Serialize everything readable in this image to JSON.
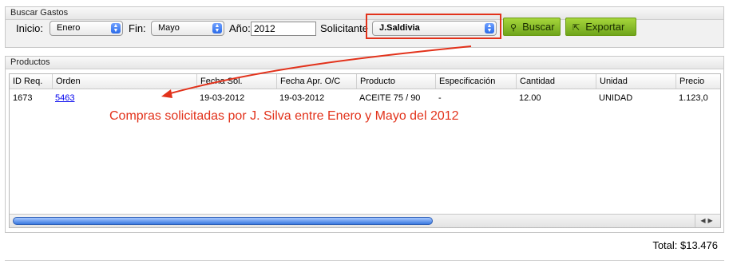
{
  "search": {
    "title": "Buscar Gastos",
    "inicio_label": "Inicio:",
    "inicio_value": "Enero",
    "fin_label": "Fin:",
    "fin_value": "Mayo",
    "anio_label": "Año:",
    "anio_value": "2012",
    "solicitante_label": "Solicitante",
    "solicitante_value": "J.Saldivia",
    "buscar_label": "Buscar",
    "exportar_label": "Exportar",
    "highlight_color": "#e2321b"
  },
  "products": {
    "title": "Productos",
    "columns": [
      "ID Req.",
      "Orden",
      "Fecha Sol.",
      "Fecha Apr. O/C",
      "Producto",
      "Especificación",
      "Cantidad",
      "Unidad",
      "Precio"
    ],
    "rows": [
      {
        "id_req": "1673",
        "orden": "5463",
        "fecha_sol": "19-03-2012",
        "fecha_apr": "19-03-2012",
        "producto": "ACEITE 75 / 90",
        "especificacion": "-",
        "cantidad": "12.00",
        "unidad": "UNIDAD",
        "precio": "1.123,0"
      }
    ]
  },
  "annotation": "Compras solicitadas por J. Silva entre Enero y Mayo del 2012",
  "total": "Total: $13.476"
}
